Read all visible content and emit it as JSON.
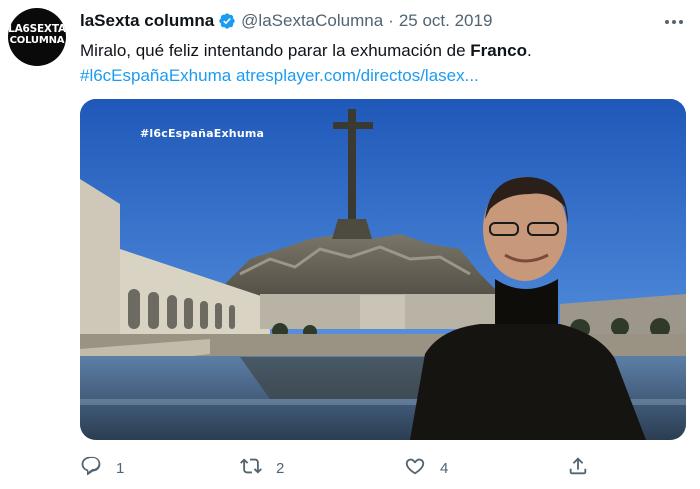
{
  "tweet": {
    "avatar_text_line1": "LA6SEXTA",
    "avatar_text_line2": "COLUMNA",
    "display_name": "laSexta columna",
    "handle": "@laSextaColumna",
    "separator": "·",
    "date": "25 oct. 2019",
    "text_part1": "Miralo, qué feliz intentando parar la exhumación de ",
    "text_bold": "Franco",
    "text_part2": ".",
    "hashtag": "#l6cEspañaExhuma",
    "url": "atresplayer.com/directos/lasex...",
    "media_overlay_text": "#l6cEspañaExhuma",
    "actions": {
      "reply_count": "1",
      "retweet_count": "2",
      "like_count": "4"
    }
  },
  "colors": {
    "link": "#1d9bf0",
    "secondary_text": "#536471",
    "verified_badge": "#1d9bf0"
  },
  "icons": [
    "verified-badge-icon",
    "more-options-icon",
    "reply-icon",
    "retweet-icon",
    "like-icon",
    "share-icon"
  ]
}
